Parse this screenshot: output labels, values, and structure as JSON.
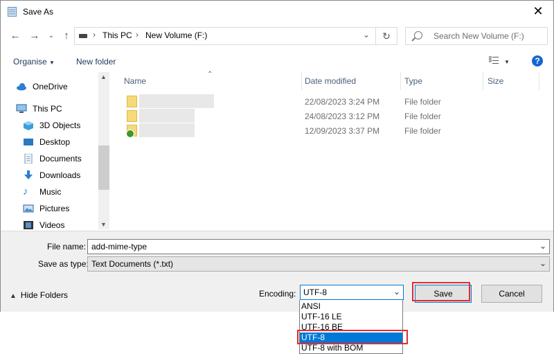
{
  "window": {
    "title": "Save As",
    "close_label": "✕"
  },
  "nav": {
    "back_icon": "arrow-left-icon",
    "forward_icon": "arrow-right-icon",
    "recent_icon": "chevron-down-icon",
    "up_icon": "arrow-up-icon",
    "breadcrumb": [
      "This PC",
      "New Volume (F:)"
    ],
    "search_placeholder": "Search New Volume (F:)"
  },
  "toolbar": {
    "organise_label": "Organise",
    "new_folder_label": "New folder",
    "help_label": "?"
  },
  "sidebar": {
    "items": [
      {
        "label": "OneDrive",
        "icon": "cloud-icon"
      },
      {
        "label": "This PC",
        "icon": "computer-icon"
      },
      {
        "label": "3D Objects",
        "icon": "cube-icon"
      },
      {
        "label": "Desktop",
        "icon": "desktop-icon"
      },
      {
        "label": "Documents",
        "icon": "document-icon"
      },
      {
        "label": "Downloads",
        "icon": "download-icon"
      },
      {
        "label": "Music",
        "icon": "music-icon"
      },
      {
        "label": "Pictures",
        "icon": "pictures-icon"
      },
      {
        "label": "Videos",
        "icon": "video-icon"
      }
    ]
  },
  "files": {
    "columns": [
      "Name",
      "Date modified",
      "Type",
      "Size"
    ],
    "rows": [
      {
        "date": "22/08/2023 3:24 PM",
        "type": "File folder"
      },
      {
        "date": "24/08/2023 3:12 PM",
        "type": "File folder"
      },
      {
        "date": "12/09/2023 3:37 PM",
        "type": "File folder"
      }
    ]
  },
  "form": {
    "file_name_label": "File name:",
    "file_name_value": "add-mime-type",
    "save_type_label": "Save as type:",
    "save_type_value": "Text Documents (*.txt)",
    "hide_folders_label": "Hide Folders",
    "encoding_label": "Encoding:",
    "encoding_value": "UTF-8",
    "encoding_options": [
      "ANSI",
      "UTF-16 LE",
      "UTF-16 BE",
      "UTF-8",
      "UTF-8 with BOM"
    ],
    "save_label": "Save",
    "cancel_label": "Cancel"
  },
  "colors": {
    "accent": "#0078d7",
    "highlight": "#e52b2b",
    "help": "#1467d2"
  }
}
